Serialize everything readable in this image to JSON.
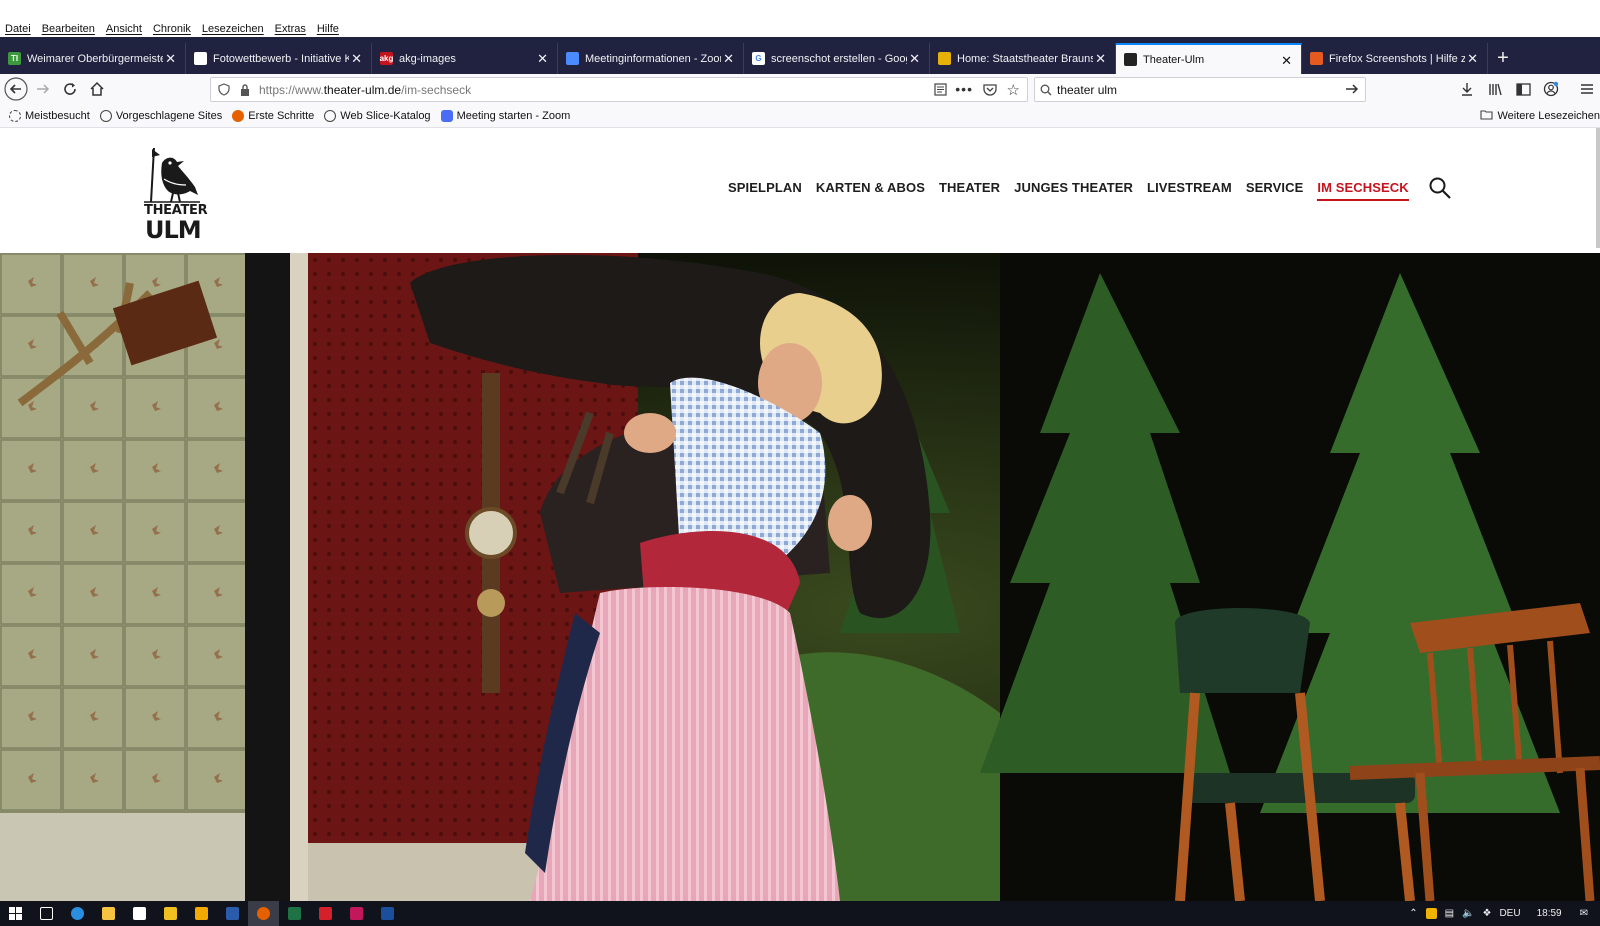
{
  "menu": [
    "Datei",
    "Bearbeiten",
    "Ansicht",
    "Chronik",
    "Lesezeichen",
    "Extras",
    "Hilfe"
  ],
  "tabs": [
    {
      "title": "Weimarer Oberbürgermeister z",
      "favicon_color": "#3c9a3c",
      "favicon_glyph": "TI",
      "active": false
    },
    {
      "title": "Fotowettbewerb - Initiative Kul",
      "favicon_color": "#ffffff",
      "favicon_glyph": "",
      "active": false
    },
    {
      "title": "akg-images",
      "favicon_color": "#c5141e",
      "favicon_glyph": "akg",
      "active": false
    },
    {
      "title": "Meetinginformationen - Zoom",
      "favicon_color": "#4a8cff",
      "favicon_glyph": "",
      "active": false
    },
    {
      "title": "screenschot erstellen - Google",
      "favicon_color": "#ffffff",
      "favicon_glyph": "G",
      "active": false
    },
    {
      "title": "Home: Staatstheater Braunsch",
      "favicon_color": "#e8b10a",
      "favicon_glyph": "",
      "active": false
    },
    {
      "title": "Theater-Ulm",
      "favicon_color": "#222222",
      "favicon_glyph": "",
      "active": true
    },
    {
      "title": "Firefox Screenshots | Hilfe zu Fi",
      "favicon_color": "#e55b1f",
      "favicon_glyph": "",
      "active": false
    }
  ],
  "url": {
    "prefix": "https://www.",
    "host": "theater-ulm.de",
    "path": "/im-sechseck"
  },
  "search": {
    "value": "theater ulm"
  },
  "bookmarks": [
    {
      "label": "Meistbesucht",
      "icon": "gear-icon"
    },
    {
      "label": "Vorgeschlagene Sites",
      "icon": "globe-icon"
    },
    {
      "label": "Erste Schritte",
      "icon": "firefox-icon"
    },
    {
      "label": "Web Slice-Katalog",
      "icon": "globe-icon"
    },
    {
      "label": "Meeting starten - Zoom",
      "icon": "zoom-icon"
    }
  ],
  "bookmarks_other": "Weitere Lesezeichen",
  "site": {
    "logo_line1": "THEATER",
    "logo_line2": "ULM",
    "nav": [
      "SPIELPLAN",
      "KARTEN & ABOS",
      "THEATER",
      "JUNGES THEATER",
      "LIVESTREAM",
      "SERVICE",
      "IM SECHSECK"
    ],
    "active_nav": "IM SECHSECK",
    "accent": "#c5141e"
  },
  "taskbar": {
    "apps": [
      {
        "name": "windows-start",
        "color": "#ffffff"
      },
      {
        "name": "task-view",
        "color": "#ffffff"
      },
      {
        "name": "edge",
        "color": "#2b8fe0"
      },
      {
        "name": "explorer",
        "color": "#f5c542"
      },
      {
        "name": "store",
        "color": "#ffffff"
      },
      {
        "name": "app-yellow",
        "color": "#f0c020"
      },
      {
        "name": "app-orange",
        "color": "#f2a900"
      },
      {
        "name": "word",
        "color": "#2b5cab"
      },
      {
        "name": "firefox",
        "color": "#e66000"
      },
      {
        "name": "excel",
        "color": "#1f7244"
      },
      {
        "name": "acrobat",
        "color": "#d4202a"
      },
      {
        "name": "indesign",
        "color": "#c2185b"
      },
      {
        "name": "photoshop",
        "color": "#1b4f9c"
      }
    ],
    "lang": "DEU",
    "time": "18:59"
  }
}
